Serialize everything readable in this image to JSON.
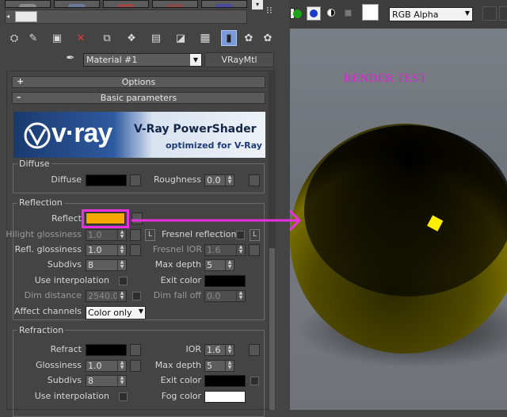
{
  "material_editor": {
    "material_name": "Material #1",
    "material_type": "VRayMtl",
    "rollouts": {
      "options": {
        "sign": "+",
        "label": "Options"
      },
      "basic": {
        "sign": "–",
        "label": "Basic parameters"
      }
    },
    "banner": {
      "logo_text": "v·ray",
      "title": "V-Ray PowerShader",
      "subtitle": "optimized for V-Ray"
    },
    "diffuse": {
      "group_title": "Diffuse",
      "diffuse_label": "Diffuse",
      "roughness_label": "Roughness",
      "roughness_value": "0.0"
    },
    "reflection": {
      "group_title": "Reflection",
      "reflect_label": "Reflect",
      "reflect_color": "#f5a800",
      "hilight_label": "Hilight glossiness",
      "hilight_value": "1.0",
      "l_button": "L",
      "fresnel_label": "Fresnel reflections",
      "refl_gloss_label": "Refl. glossiness",
      "refl_gloss_value": "1.0",
      "fresnel_ior_label": "Fresnel IOR",
      "fresnel_ior_value": "1.6",
      "subdivs_label": "Subdivs",
      "subdivs_value": "8",
      "max_depth_label": "Max depth",
      "max_depth_value": "5",
      "use_interp_label": "Use interpolation",
      "exit_color_label": "Exit color",
      "dim_distance_label": "Dim distance",
      "dim_distance_value": "2540.0",
      "dim_falloff_label": "Dim fall off",
      "dim_falloff_value": "0.0",
      "affect_channels_label": "Affect channels",
      "affect_channels_value": "Color only"
    },
    "refraction": {
      "group_title": "Refraction",
      "refract_label": "Refract",
      "ior_label": "IOR",
      "ior_value": "1.6",
      "glossiness_label": "Glossiness",
      "glossiness_value": "1.0",
      "max_depth_label": "Max depth",
      "max_depth_value": "5",
      "subdivs_label": "Subdivs",
      "subdivs_value": "8",
      "exit_color_label": "Exit color",
      "use_interp_label": "Use interpolation",
      "fog_color_label": "Fog color"
    },
    "toolbar_icons": [
      "get-material-icon",
      "put-material-icon",
      "assign-material-icon",
      "reset-icon",
      "copy-material-icon",
      "make-unique-icon",
      "put-to-library-icon",
      "material-id-icon",
      "show-map-icon",
      "show-end-result-icon",
      "go-to-parent-icon",
      "go-forward-icon",
      "pick-material-icon"
    ]
  },
  "render_window": {
    "channel": "RGB Alpha",
    "annotation": "RENDER TEST",
    "annotation_color": "#e020d8",
    "sphere_color": "#7a7000",
    "highlight_color": "#ffee00"
  }
}
